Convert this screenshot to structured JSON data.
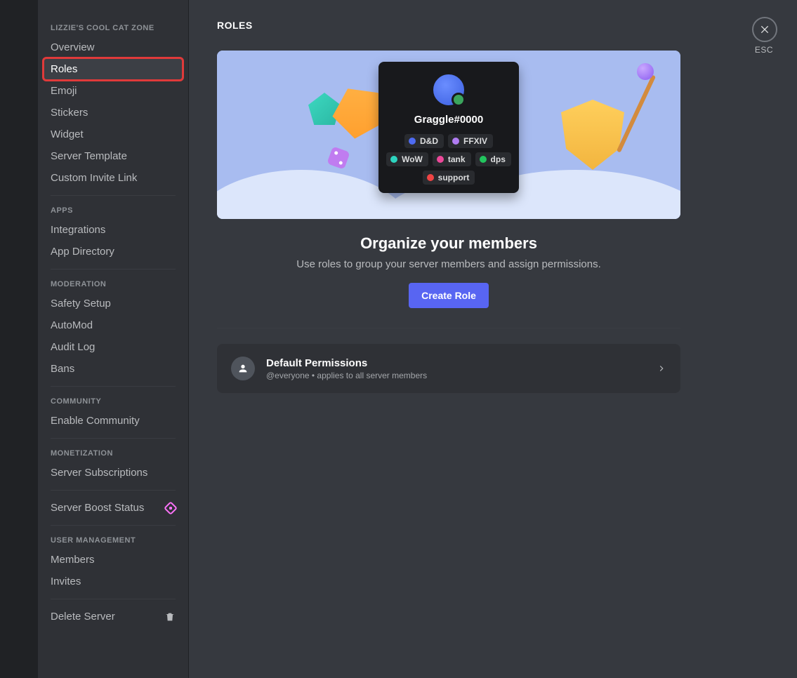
{
  "sidebar": {
    "server_name": "LIZZIE'S COOL CAT ZONE",
    "groups": [
      {
        "heading": null,
        "items": [
          "Overview",
          "Roles",
          "Emoji",
          "Stickers",
          "Widget",
          "Server Template",
          "Custom Invite Link"
        ]
      },
      {
        "heading": "APPS",
        "items": [
          "Integrations",
          "App Directory"
        ]
      },
      {
        "heading": "MODERATION",
        "items": [
          "Safety Setup",
          "AutoMod",
          "Audit Log",
          "Bans"
        ]
      },
      {
        "heading": "COMMUNITY",
        "items": [
          "Enable Community"
        ]
      },
      {
        "heading": "MONETIZATION",
        "items": [
          "Server Subscriptions"
        ]
      }
    ],
    "boost_item": "Server Boost Status",
    "user_mgmt_heading": "USER MANAGEMENT",
    "user_mgmt_items": [
      "Members",
      "Invites"
    ],
    "delete_item": "Delete Server",
    "active_item": "Roles"
  },
  "main": {
    "title": "ROLES",
    "esc_label": "ESC",
    "profile": {
      "name": "Graggle#0000",
      "roles": [
        {
          "label": "D&D",
          "color": "#4e6bf2"
        },
        {
          "label": "FFXIV",
          "color": "#b07cf2"
        },
        {
          "label": "WoW",
          "color": "#2dd4bf"
        },
        {
          "label": "tank",
          "color": "#ec4899"
        },
        {
          "label": "dps",
          "color": "#22c55e"
        },
        {
          "label": "support",
          "color": "#ef4444"
        }
      ]
    },
    "intro": {
      "heading": "Organize your members",
      "body": "Use roles to group your server members and assign permissions.",
      "cta": "Create Role"
    },
    "permissions_row": {
      "title": "Default Permissions",
      "subtitle": "@everyone • applies to all server members"
    }
  }
}
